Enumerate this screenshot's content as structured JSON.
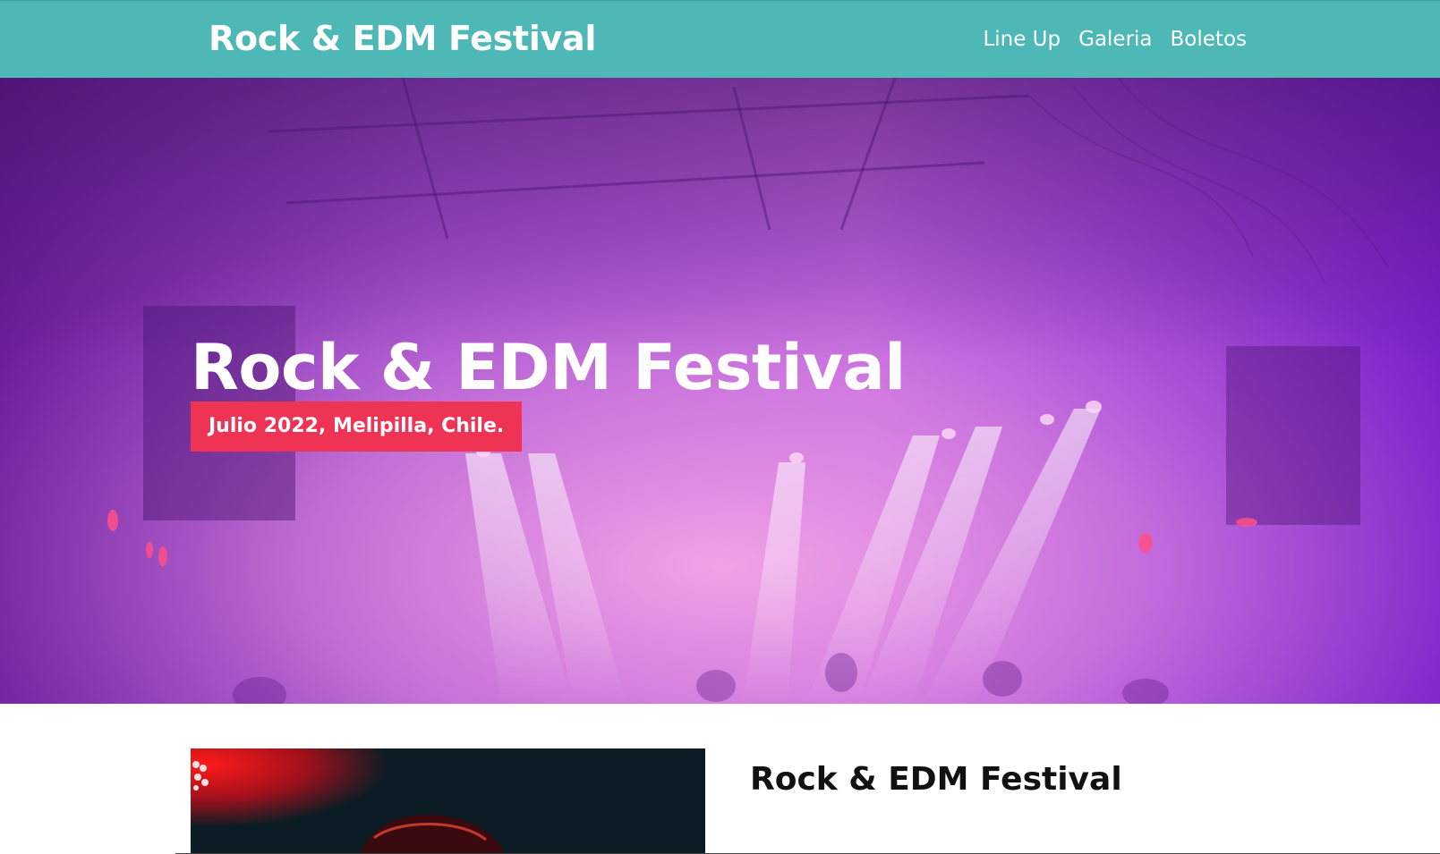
{
  "header": {
    "brand": "Rock & EDM Festival",
    "nav": [
      "Line Up",
      "Galeria",
      "Boletos"
    ],
    "background_color": "#4db8b5"
  },
  "hero": {
    "title": "Rock & EDM Festival",
    "badge": "Julio 2022, Melipilla, Chile.",
    "badge_color": "#ef3355",
    "overlay_colors": [
      "#7a2aa8",
      "#d680e0",
      "#8a2be2"
    ]
  },
  "content": {
    "title": "Rock & EDM Festival"
  }
}
